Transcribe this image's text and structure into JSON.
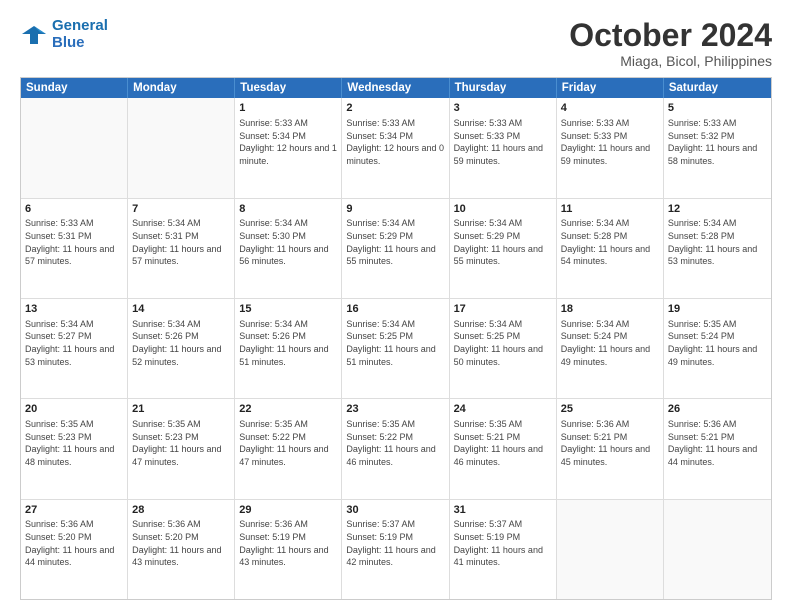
{
  "logo": {
    "text_general": "General",
    "text_blue": "Blue"
  },
  "title": "October 2024",
  "subtitle": "Miaga, Bicol, Philippines",
  "header_days": [
    "Sunday",
    "Monday",
    "Tuesday",
    "Wednesday",
    "Thursday",
    "Friday",
    "Saturday"
  ],
  "weeks": [
    [
      {
        "day": "",
        "info": ""
      },
      {
        "day": "",
        "info": ""
      },
      {
        "day": "1",
        "info": "Sunrise: 5:33 AM\nSunset: 5:34 PM\nDaylight: 12 hours and 1 minute."
      },
      {
        "day": "2",
        "info": "Sunrise: 5:33 AM\nSunset: 5:34 PM\nDaylight: 12 hours and 0 minutes."
      },
      {
        "day": "3",
        "info": "Sunrise: 5:33 AM\nSunset: 5:33 PM\nDaylight: 11 hours and 59 minutes."
      },
      {
        "day": "4",
        "info": "Sunrise: 5:33 AM\nSunset: 5:33 PM\nDaylight: 11 hours and 59 minutes."
      },
      {
        "day": "5",
        "info": "Sunrise: 5:33 AM\nSunset: 5:32 PM\nDaylight: 11 hours and 58 minutes."
      }
    ],
    [
      {
        "day": "6",
        "info": "Sunrise: 5:33 AM\nSunset: 5:31 PM\nDaylight: 11 hours and 57 minutes."
      },
      {
        "day": "7",
        "info": "Sunrise: 5:34 AM\nSunset: 5:31 PM\nDaylight: 11 hours and 57 minutes."
      },
      {
        "day": "8",
        "info": "Sunrise: 5:34 AM\nSunset: 5:30 PM\nDaylight: 11 hours and 56 minutes."
      },
      {
        "day": "9",
        "info": "Sunrise: 5:34 AM\nSunset: 5:29 PM\nDaylight: 11 hours and 55 minutes."
      },
      {
        "day": "10",
        "info": "Sunrise: 5:34 AM\nSunset: 5:29 PM\nDaylight: 11 hours and 55 minutes."
      },
      {
        "day": "11",
        "info": "Sunrise: 5:34 AM\nSunset: 5:28 PM\nDaylight: 11 hours and 54 minutes."
      },
      {
        "day": "12",
        "info": "Sunrise: 5:34 AM\nSunset: 5:28 PM\nDaylight: 11 hours and 53 minutes."
      }
    ],
    [
      {
        "day": "13",
        "info": "Sunrise: 5:34 AM\nSunset: 5:27 PM\nDaylight: 11 hours and 53 minutes."
      },
      {
        "day": "14",
        "info": "Sunrise: 5:34 AM\nSunset: 5:26 PM\nDaylight: 11 hours and 52 minutes."
      },
      {
        "day": "15",
        "info": "Sunrise: 5:34 AM\nSunset: 5:26 PM\nDaylight: 11 hours and 51 minutes."
      },
      {
        "day": "16",
        "info": "Sunrise: 5:34 AM\nSunset: 5:25 PM\nDaylight: 11 hours and 51 minutes."
      },
      {
        "day": "17",
        "info": "Sunrise: 5:34 AM\nSunset: 5:25 PM\nDaylight: 11 hours and 50 minutes."
      },
      {
        "day": "18",
        "info": "Sunrise: 5:34 AM\nSunset: 5:24 PM\nDaylight: 11 hours and 49 minutes."
      },
      {
        "day": "19",
        "info": "Sunrise: 5:35 AM\nSunset: 5:24 PM\nDaylight: 11 hours and 49 minutes."
      }
    ],
    [
      {
        "day": "20",
        "info": "Sunrise: 5:35 AM\nSunset: 5:23 PM\nDaylight: 11 hours and 48 minutes."
      },
      {
        "day": "21",
        "info": "Sunrise: 5:35 AM\nSunset: 5:23 PM\nDaylight: 11 hours and 47 minutes."
      },
      {
        "day": "22",
        "info": "Sunrise: 5:35 AM\nSunset: 5:22 PM\nDaylight: 11 hours and 47 minutes."
      },
      {
        "day": "23",
        "info": "Sunrise: 5:35 AM\nSunset: 5:22 PM\nDaylight: 11 hours and 46 minutes."
      },
      {
        "day": "24",
        "info": "Sunrise: 5:35 AM\nSunset: 5:21 PM\nDaylight: 11 hours and 46 minutes."
      },
      {
        "day": "25",
        "info": "Sunrise: 5:36 AM\nSunset: 5:21 PM\nDaylight: 11 hours and 45 minutes."
      },
      {
        "day": "26",
        "info": "Sunrise: 5:36 AM\nSunset: 5:21 PM\nDaylight: 11 hours and 44 minutes."
      }
    ],
    [
      {
        "day": "27",
        "info": "Sunrise: 5:36 AM\nSunset: 5:20 PM\nDaylight: 11 hours and 44 minutes."
      },
      {
        "day": "28",
        "info": "Sunrise: 5:36 AM\nSunset: 5:20 PM\nDaylight: 11 hours and 43 minutes."
      },
      {
        "day": "29",
        "info": "Sunrise: 5:36 AM\nSunset: 5:19 PM\nDaylight: 11 hours and 43 minutes."
      },
      {
        "day": "30",
        "info": "Sunrise: 5:37 AM\nSunset: 5:19 PM\nDaylight: 11 hours and 42 minutes."
      },
      {
        "day": "31",
        "info": "Sunrise: 5:37 AM\nSunset: 5:19 PM\nDaylight: 11 hours and 41 minutes."
      },
      {
        "day": "",
        "info": ""
      },
      {
        "day": "",
        "info": ""
      }
    ]
  ]
}
